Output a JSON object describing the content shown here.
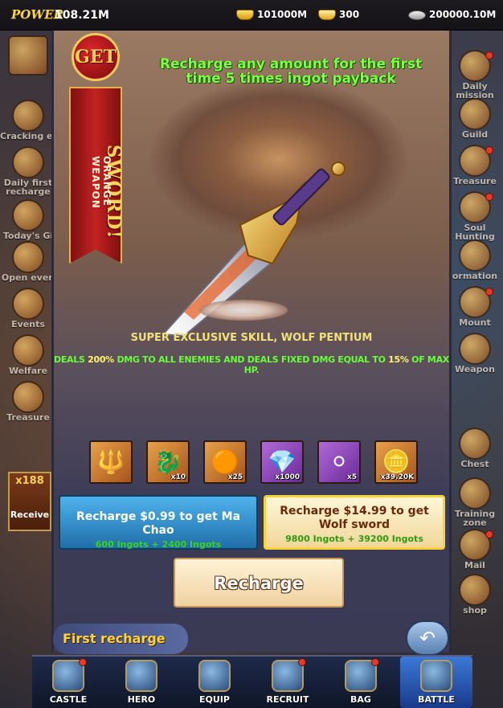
{
  "topbar": {
    "power_label": "POWER",
    "power_value": "108.21M",
    "gold": "101000M",
    "ingots": "300",
    "silver": "200000.10M"
  },
  "left_menu": [
    {
      "label": "Cracking egg"
    },
    {
      "label": "Daily first recharge"
    },
    {
      "label": "Today's Gi"
    },
    {
      "label": "Open even"
    },
    {
      "label": "Events"
    },
    {
      "label": "Welfare"
    },
    {
      "label": "Treasure"
    }
  ],
  "receive": {
    "count": "x188",
    "label": "Receive"
  },
  "right_menu": [
    {
      "label": "Daily mission"
    },
    {
      "label": "Guild"
    },
    {
      "label": "Treasure"
    },
    {
      "label": "Soul Hunting"
    },
    {
      "label": "ormation"
    },
    {
      "label": "Mount"
    },
    {
      "label": "Weapon"
    },
    {
      "label": "Chest"
    },
    {
      "label": "Training zone"
    },
    {
      "label": "Mail"
    },
    {
      "label": "shop"
    }
  ],
  "popup": {
    "headline": "Recharge any amount for the first time 5 times ingot payback",
    "banner_get": "GET",
    "banner_title": "WOLF SWORD!",
    "banner_sub": "ORANGE WEAPON",
    "skill_title": "SUPER EXCLUSIVE SKILL, WOLF PENTIUM",
    "skill_desc_1": "DEALS ",
    "skill_desc_2": "200%",
    "skill_desc_3": " DMG TO ALL ENEMIES AND DEALS FIXED DMG EQUAL TO ",
    "skill_desc_4": "15%",
    "skill_desc_5": " OF MAX HP.",
    "items": [
      {
        "icon": "trident-icon",
        "qty": ""
      },
      {
        "icon": "dragon-token-icon",
        "qty": "x10"
      },
      {
        "icon": "orb-icon",
        "qty": "x25"
      },
      {
        "icon": "crystal-icon",
        "qty": "x1000"
      },
      {
        "icon": "silver-ingot-icon",
        "qty": "x5"
      },
      {
        "icon": "gold-ingot-icon",
        "qty": "x39.20K"
      }
    ],
    "option_blue": {
      "label": "Recharge $0.99 to get Ma Chao",
      "sub": "600 Ingots + 2400 Ingots"
    },
    "option_gold": {
      "label": "Recharge $14.99 to get Wolf sword",
      "sub": "9800 Ingots + 39200 Ingots"
    },
    "recharge_button": "Recharge",
    "gift_label": "First recharge gift"
  },
  "bottom_nav": [
    {
      "label": "CASTLE"
    },
    {
      "label": "HERO"
    },
    {
      "label": "EQUIP"
    },
    {
      "label": "RECRUIT"
    },
    {
      "label": "BAG"
    },
    {
      "label": "BATTLE"
    }
  ]
}
